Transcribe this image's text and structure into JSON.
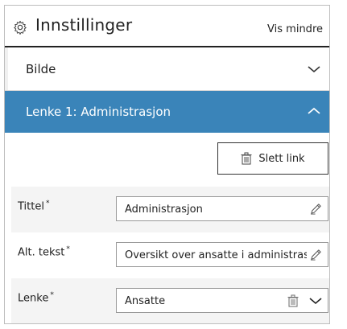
{
  "header": {
    "title": "Innstillinger",
    "toggle_label": "Vis mindre"
  },
  "sections": {
    "bilde": "Bilde",
    "lenke": "Lenke 1: Administrasjon"
  },
  "actions": {
    "delete_link": "Slett link"
  },
  "fields": [
    {
      "label": "Tittel",
      "required": "*",
      "value": "Administrasjon"
    },
    {
      "label": "Alt. tekst",
      "required": "*",
      "value": "Oversikt over ansatte i administrasjonen"
    },
    {
      "label": "Lenke",
      "required": "*",
      "value": "Ansatte"
    }
  ],
  "colors": {
    "accent": "#3a84b9"
  }
}
